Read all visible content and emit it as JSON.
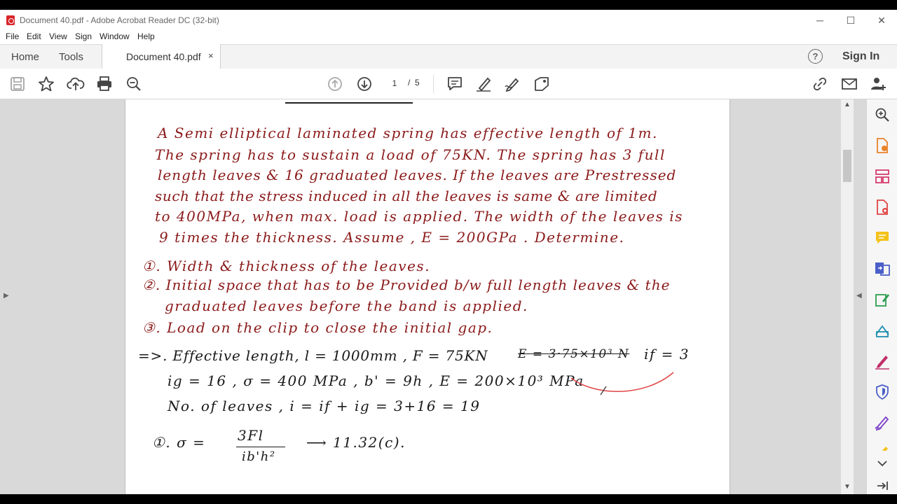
{
  "window": {
    "title": "Document 40.pdf - Adobe Acrobat Reader DC (32-bit)",
    "minimize": "─",
    "maximize": "☐",
    "close": "✕"
  },
  "menu": [
    "File",
    "Edit",
    "View",
    "Sign",
    "Window",
    "Help"
  ],
  "tabs": {
    "home": "Home",
    "tools": "Tools",
    "document": "Document 40.pdf",
    "close": "×",
    "help": "?",
    "signin": "Sign In"
  },
  "toolbar": {
    "page_current": "1",
    "page_separator": "/",
    "page_total": "5",
    "icons": [
      "save-icon",
      "star-icon",
      "upload-icon",
      "print-icon",
      "zoom-out-icon",
      "page-up-icon",
      "page-down-icon",
      "comment-icon",
      "highlight-icon",
      "sign-icon",
      "stamp-icon",
      "share-link-icon",
      "email-icon",
      "add-user-icon"
    ]
  },
  "document": {
    "lines": [
      "A Semi elliptical laminated spring has effective length of 1m.",
      "The spring has to sustain a load of 75KN. The spring has 3 full",
      "length leaves & 16 graduated leaves. If the leaves are Prestressed",
      "such that the stress induced in all the leaves is same & are limited",
      "to 400MPa, when max. load is applied. The width of the leaves is",
      "9 times the thickness. Assume , E = 200GPa . Determine.",
      "①. Width & thickness of the leaves.",
      "②. Initial space that has to be Provided b/w full length leaves & the",
      "graduated leaves before the band is applied.",
      "③. Load on the clip to close the initial gap.",
      "=>. Effective length, l = 1000mm , F = 75KN",
      "E = 3·75×10³ N",
      "if = 3",
      "ig = 16 , σ = 400 MPa , b' = 9h , E = 200×10³ MPa",
      "No. of leaves , i = if + ig = 3+16 = 19",
      "①.   σ =",
      "3Fl",
      "ib'h²",
      "⟶ 11.32(c)."
    ]
  },
  "right_panel_icons": [
    "search-zoom-icon",
    "export-pdf-icon",
    "organize-pages-icon",
    "create-pdf-icon",
    "comment-panel-icon",
    "combine-files-icon",
    "edit-pdf-icon",
    "scan-icon",
    "fill-sign-icon",
    "protect-icon",
    "send-sign-icon",
    "more-tools-icon",
    "collapse-panel-icon"
  ],
  "colors": {
    "ink_red": "#8b1a1a",
    "ink_black": "#1a1a1a",
    "accent_red": "#d7262b"
  }
}
